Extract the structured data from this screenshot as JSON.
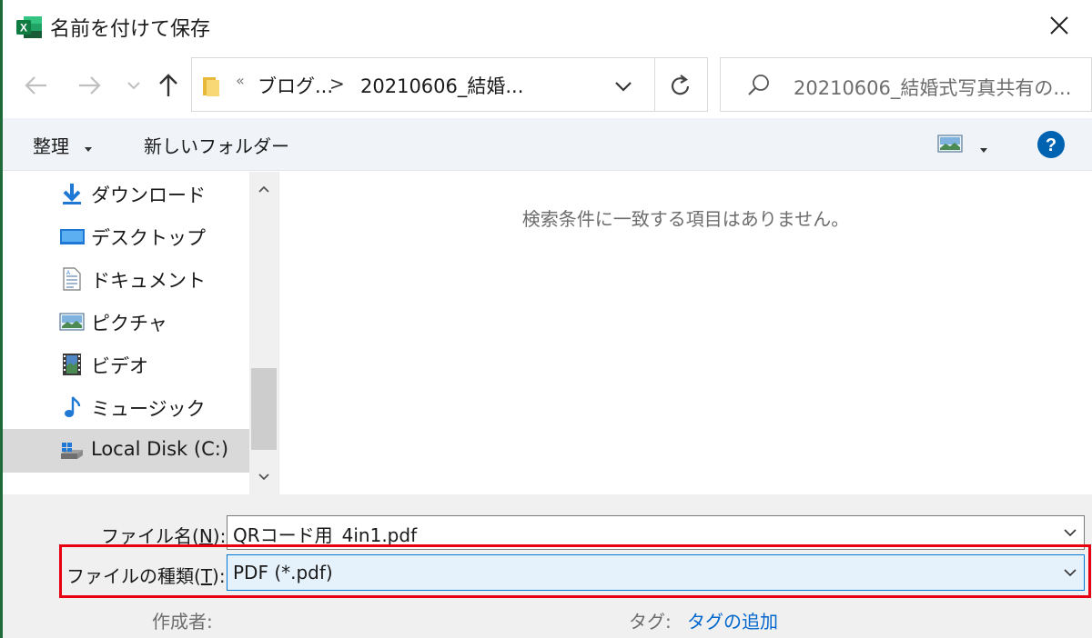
{
  "window": {
    "title": "名前を付けて保存",
    "app_icon": "excel-icon",
    "close_icon": "close-icon"
  },
  "navigation": {
    "back_icon": "back-arrow-icon",
    "forward_icon": "forward-arrow-icon",
    "recent_icon": "chevron-down-icon",
    "up_icon": "up-arrow-icon",
    "address": {
      "overflow_marker": "«",
      "segments": [
        "ブログ...",
        "20210606_結婚..."
      ],
      "separator": ">"
    },
    "refresh_icon": "refresh-icon",
    "search": {
      "placeholder": "20210606_結婚式写真共有の..."
    }
  },
  "toolbar": {
    "organize_label": "整理",
    "new_folder_label": "新しいフォルダー",
    "view_icon": "view-thumbnail-icon",
    "help_label": "?"
  },
  "sidebar": {
    "items": [
      {
        "label": "ダウンロード",
        "icon": "downloads-icon"
      },
      {
        "label": "デスクトップ",
        "icon": "desktop-icon"
      },
      {
        "label": "ドキュメント",
        "icon": "documents-icon"
      },
      {
        "label": "ピクチャ",
        "icon": "pictures-icon"
      },
      {
        "label": "ビデオ",
        "icon": "videos-icon"
      },
      {
        "label": "ミュージック",
        "icon": "music-icon"
      },
      {
        "label": "Local Disk (C:)",
        "icon": "local-disk-icon",
        "selected": true
      }
    ]
  },
  "content": {
    "empty_message": "検索条件に一致する項目はありません。"
  },
  "form": {
    "filename_label_pre": "ファイル名(",
    "filename_label_key": "N",
    "filename_label_post": "):",
    "filename_value": "QRコード用_4in1.pdf",
    "filetype_label_pre": "ファイルの種類(",
    "filetype_label_key": "T",
    "filetype_label_post": "):",
    "filetype_value": "PDF (*.pdf)",
    "author_label": "作成者:",
    "tags_label": "タグ:",
    "tags_link": "タグの追加"
  },
  "colors": {
    "highlight_border": "#e60012",
    "accent": "#0078d7",
    "help_bg": "#0063b1",
    "link": "#0066cc",
    "excel_green": "#1e6a3a"
  }
}
